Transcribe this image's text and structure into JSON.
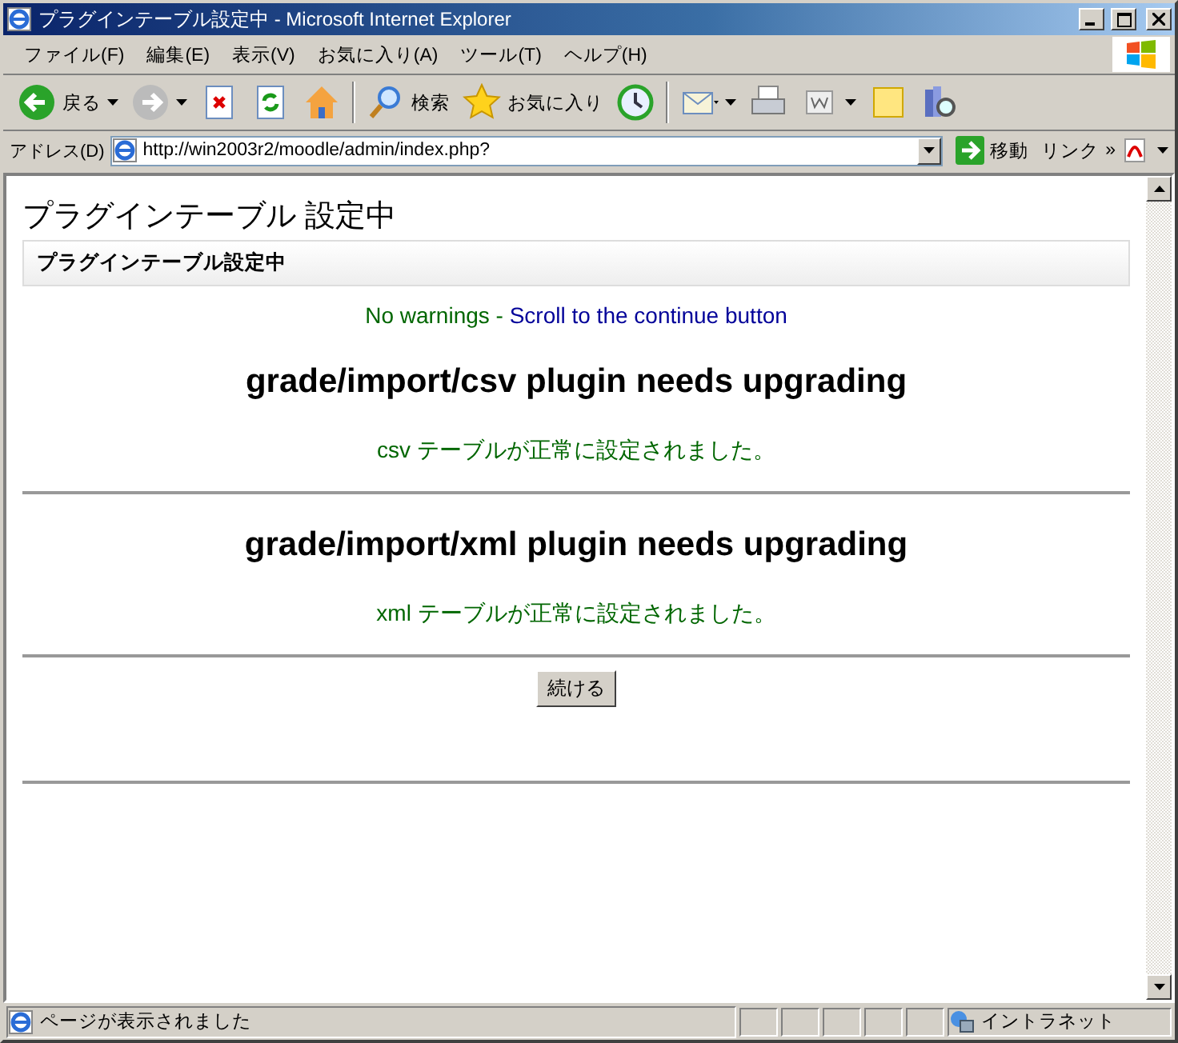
{
  "window": {
    "title": "プラグインテーブル設定中 - Microsoft Internet Explorer"
  },
  "menu": [
    "ファイル(F)",
    "編集(E)",
    "表示(V)",
    "お気に入り(A)",
    "ツール(T)",
    "ヘルプ(H)"
  ],
  "toolbar": [
    {
      "kind": "back",
      "label": "戻る"
    },
    {
      "kind": "forward"
    },
    {
      "kind": "stop"
    },
    {
      "kind": "refresh"
    },
    {
      "kind": "home"
    },
    {
      "kind": "search",
      "label": "検索"
    },
    {
      "kind": "favorites",
      "label": "お気に入り"
    },
    {
      "kind": "history"
    },
    {
      "kind": "mail"
    },
    {
      "kind": "print"
    },
    {
      "kind": "edit"
    },
    {
      "kind": "notes"
    },
    {
      "kind": "research"
    }
  ],
  "address": {
    "label": "アドレス(D)",
    "url": "http://win2003r2/moodle/admin/index.php?",
    "go": "移動",
    "links": "リンク",
    "more": "»"
  },
  "page": {
    "heading": "プラグインテーブル 設定中",
    "box_title": "プラグインテーブル設定中",
    "notice": {
      "text": "No warnings - ",
      "link": "Scroll to the continue button"
    },
    "sections": [
      {
        "title": "grade/import/csv plugin needs upgrading",
        "message": "csv テーブルが正常に設定されました。"
      },
      {
        "title": "grade/import/xml plugin needs upgrading",
        "message": "xml テーブルが正常に設定されました。"
      }
    ],
    "continue_button": "続ける"
  },
  "status": {
    "text": "ページが表示されました",
    "zone": "イントラネット"
  }
}
